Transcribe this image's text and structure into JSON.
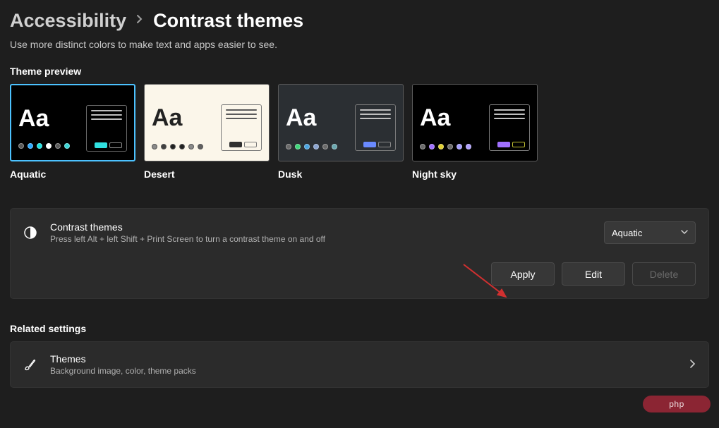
{
  "breadcrumb": {
    "parent": "Accessibility",
    "current": "Contrast themes"
  },
  "description": "Use more distinct colors to make text and apps easier to see.",
  "sections": {
    "preview_label": "Theme preview",
    "related_label": "Related settings"
  },
  "themes": [
    {
      "name": "Aquatic",
      "bg": "#000000",
      "fg": "#ffffff",
      "dots": [
        "#5a5a5a",
        "#2aa8ff",
        "#1ae0e0",
        "#ffffff",
        "#5a5a5a",
        "#3bd6d6"
      ],
      "mini_border": "#6a6a6a",
      "mini_line": "#c0c0c0",
      "mini_btn1": "#30e0e0",
      "mini_btn2": "#8a8a8a"
    },
    {
      "name": "Desert",
      "bg": "#fbf6ea",
      "fg": "#222222",
      "dots": [
        "#8a8a8a",
        "#404040",
        "#202020",
        "#202020",
        "#8a8a8a",
        "#606060"
      ],
      "mini_border": "#7a7a7a",
      "mini_line": "#5a5a5a",
      "mini_btn1": "#303030",
      "mini_btn2": "#a8a8a8"
    },
    {
      "name": "Dusk",
      "bg": "#2b2f33",
      "fg": "#ffffff",
      "dots": [
        "#6a6a6a",
        "#3fd67a",
        "#4aa4e0",
        "#8aa4d0",
        "#6a6a6a",
        "#6aa8b0"
      ],
      "mini_border": "#7a7a7a",
      "mini_line": "#c0c0c0",
      "mini_btn1": "#6a8aff",
      "mini_btn2": "#8a8a8a"
    },
    {
      "name": "Night sky",
      "bg": "#000000",
      "fg": "#ffffff",
      "dots": [
        "#6a6a6a",
        "#a070ff",
        "#e0d030",
        "#6a6a6a",
        "#a6a0ff",
        "#b0a0ff"
      ],
      "mini_border": "#7a7a7a",
      "mini_line": "#c0c0c0",
      "mini_btn1": "#a070ff",
      "mini_btn2": "#c0c030"
    }
  ],
  "contrast_card": {
    "title": "Contrast themes",
    "subtitle": "Press left Alt + left Shift + Print Screen to turn a contrast theme on and off",
    "selected": "Aquatic",
    "buttons": {
      "apply": "Apply",
      "edit": "Edit",
      "delete": "Delete"
    }
  },
  "related": {
    "title": "Themes",
    "subtitle": "Background image, color, theme packs"
  },
  "watermark": "php"
}
